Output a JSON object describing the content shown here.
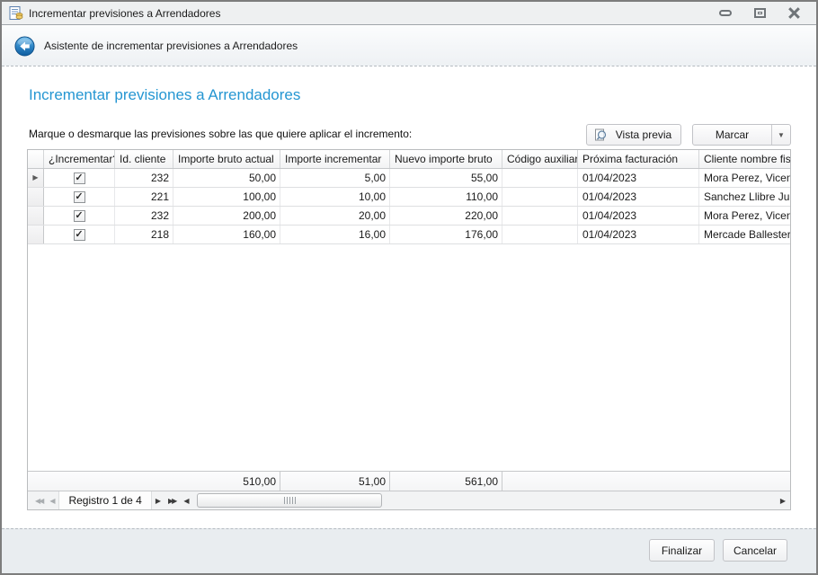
{
  "window": {
    "title": "Incrementar previsiones a Arrendadores"
  },
  "wizard_header": {
    "title": "Asistente de incrementar previsiones a Arrendadores"
  },
  "main": {
    "heading": "Incrementar previsiones a Arrendadores",
    "instruction": "Marque o desmarque las previsiones sobre las que quiere aplicar el incremento:",
    "preview_button": "Vista previa",
    "mark_button": "Marcar"
  },
  "grid": {
    "columns": {
      "increment": "¿Incrementar?",
      "client_id": "Id. cliente",
      "gross_current": "Importe bruto actual",
      "increase": "Importe incrementar",
      "gross_new": "Nuevo importe bruto",
      "aux_code": "Código auxiliar",
      "next_billing": "Próxima facturación",
      "client_name": "Cliente nombre fiscal"
    },
    "rows": [
      {
        "checked": true,
        "client_id": "232",
        "gross_current": "50,00",
        "increase": "5,00",
        "gross_new": "55,00",
        "aux_code": "",
        "next_billing": "01/04/2023",
        "client_name": "Mora Perez, Vicente"
      },
      {
        "checked": true,
        "client_id": "221",
        "gross_current": "100,00",
        "increase": "10,00",
        "gross_new": "110,00",
        "aux_code": "",
        "next_billing": "01/04/2023",
        "client_name": "Sanchez Llibre Julian"
      },
      {
        "checked": true,
        "client_id": "232",
        "gross_current": "200,00",
        "increase": "20,00",
        "gross_new": "220,00",
        "aux_code": "",
        "next_billing": "01/04/2023",
        "client_name": "Mora Perez, Vicente"
      },
      {
        "checked": true,
        "client_id": "218",
        "gross_current": "160,00",
        "increase": "16,00",
        "gross_new": "176,00",
        "aux_code": "",
        "next_billing": "01/04/2023",
        "client_name": "Mercade Ballesteros,"
      }
    ],
    "summary": {
      "gross_current": "510,00",
      "increase": "51,00",
      "gross_new": "561,00"
    },
    "current_row": 0,
    "navigator": {
      "record_label": "Registro 1 de 4"
    }
  },
  "footer": {
    "finish_button": "Finalizar",
    "cancel_button": "Cancelar"
  },
  "icons": {
    "check": "✓",
    "row_marker": "▶",
    "nav_first": "◀◀",
    "nav_prev": "◀",
    "nav_next": "▶",
    "nav_last": "▶▶",
    "scroll_left": "◀",
    "scroll_right": "▶",
    "dropdown": "▼"
  },
  "colors": {
    "heading_accent": "#2596d2"
  }
}
